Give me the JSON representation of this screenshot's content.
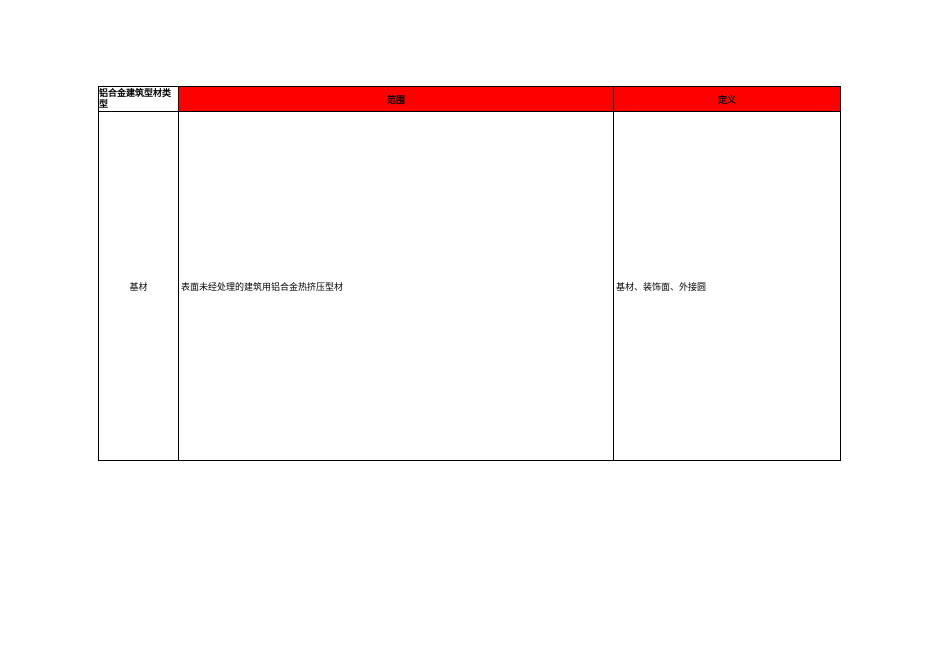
{
  "header": {
    "col1": "铝合金建筑型材类型",
    "col2": "范围",
    "col3": "定义"
  },
  "row": {
    "type": "基材",
    "scope": "表面未经处理的建筑用铝合金热挤压型材",
    "definition": "基材、装饰面、外接圆"
  }
}
